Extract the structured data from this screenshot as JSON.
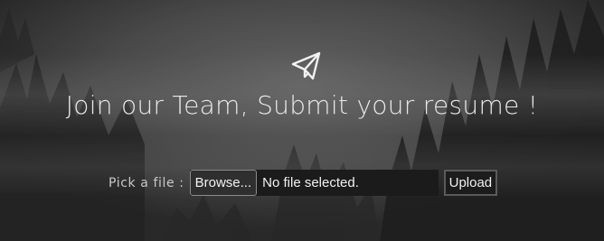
{
  "hero": {
    "icon": "paper-plane-icon",
    "headline": "Join our Team, Submit your resume !"
  },
  "upload_form": {
    "pick_label": "Pick a file :",
    "browse_label": "Browse...",
    "file_status": "No file selected.",
    "upload_label": "Upload"
  },
  "background": {
    "description_colors": {
      "base": "#3a3a3a",
      "fog": "#6e6e6e",
      "trees_dark": "#1f1f1f"
    }
  }
}
